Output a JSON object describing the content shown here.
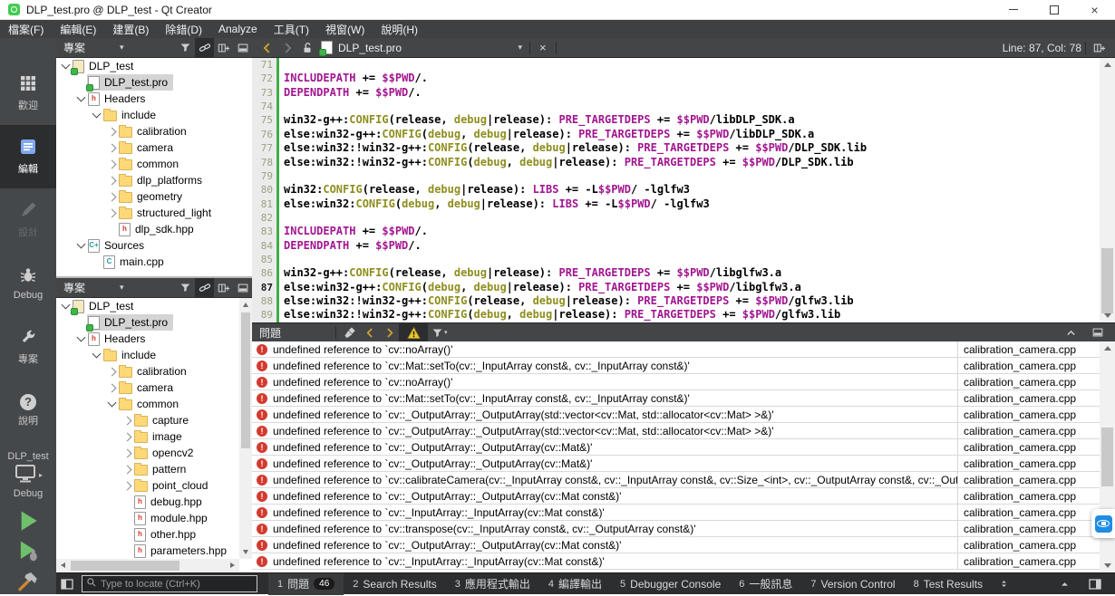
{
  "window": {
    "title": "DLP_test.pro @ DLP_test - Qt Creator",
    "controls": [
      "minimize",
      "restore",
      "close"
    ]
  },
  "menu_bar": {
    "items": [
      "檔案(F)",
      "編輯(E)",
      "建置(B)",
      "除錯(D)",
      "Analyze",
      "工具(T)",
      "視窗(W)",
      "說明(H)"
    ]
  },
  "mode_bar": {
    "modes": [
      {
        "label": "歡迎",
        "icon": "welcome-icon",
        "state": "normal"
      },
      {
        "label": "編輯",
        "icon": "edit-icon",
        "state": "selected"
      },
      {
        "label": "設計",
        "icon": "design-icon",
        "state": "disabled"
      },
      {
        "label": "Debug",
        "icon": "debug-icon",
        "state": "normal"
      },
      {
        "label": "專案",
        "icon": "projects-icon",
        "state": "normal"
      },
      {
        "label": "說明",
        "icon": "help-icon",
        "state": "normal"
      }
    ],
    "kit": {
      "project": "DLP_test",
      "config": "Debug"
    },
    "actions": [
      {
        "name": "run",
        "icon": "play-icon"
      },
      {
        "name": "debug-run",
        "icon": "play-bug-icon"
      },
      {
        "name": "build",
        "icon": "hammer-icon"
      }
    ]
  },
  "nav_panels": {
    "top": {
      "title": "專案",
      "toolbar_icons": [
        "dropdown-arrow",
        "filter-icon",
        "link-editor-icon",
        "split-icon",
        "hide-panel-icon"
      ],
      "tree": [
        {
          "label": "DLP_test",
          "icon": "qt-project-icon",
          "depth": 0,
          "exp": "open"
        },
        {
          "label": "DLP_test.pro",
          "icon": "pro-file-icon",
          "depth": 1,
          "exp": "none",
          "selected": true
        },
        {
          "label": "Headers",
          "icon": "header-file-icon",
          "depth": 1,
          "exp": "open"
        },
        {
          "label": "include",
          "icon": "folder-icon",
          "depth": 2,
          "exp": "open"
        },
        {
          "label": "calibration",
          "icon": "folder-icon",
          "depth": 3,
          "exp": "closed"
        },
        {
          "label": "camera",
          "icon": "folder-icon",
          "depth": 3,
          "exp": "closed"
        },
        {
          "label": "common",
          "icon": "folder-icon",
          "depth": 3,
          "exp": "closed"
        },
        {
          "label": "dlp_platforms",
          "icon": "folder-icon",
          "depth": 3,
          "exp": "closed"
        },
        {
          "label": "geometry",
          "icon": "folder-icon",
          "depth": 3,
          "exp": "closed"
        },
        {
          "label": "structured_light",
          "icon": "folder-icon",
          "depth": 3,
          "exp": "closed"
        },
        {
          "label": "dlp_sdk.hpp",
          "icon": "header-file-icon",
          "depth": 3,
          "exp": "none"
        },
        {
          "label": "Sources",
          "icon": "source-group-icon",
          "depth": 1,
          "exp": "open"
        },
        {
          "label": "main.cpp",
          "icon": "cpp-file-icon",
          "depth": 2,
          "exp": "none"
        }
      ]
    },
    "bottom": {
      "title": "專案",
      "toolbar_icons": [
        "dropdown-arrow",
        "filter-icon",
        "link-editor-icon",
        "split-icon",
        "hide-panel-icon"
      ],
      "tree": [
        {
          "label": "DLP_test",
          "icon": "qt-project-icon",
          "depth": 0,
          "exp": "open"
        },
        {
          "label": "DLP_test.pro",
          "icon": "pro-file-icon",
          "depth": 1,
          "exp": "none",
          "selected": true
        },
        {
          "label": "Headers",
          "icon": "header-file-icon",
          "depth": 1,
          "exp": "open"
        },
        {
          "label": "include",
          "icon": "folder-icon",
          "depth": 2,
          "exp": "open"
        },
        {
          "label": "calibration",
          "icon": "folder-icon",
          "depth": 3,
          "exp": "closed"
        },
        {
          "label": "camera",
          "icon": "folder-icon",
          "depth": 3,
          "exp": "closed"
        },
        {
          "label": "common",
          "icon": "folder-icon",
          "depth": 3,
          "exp": "open"
        },
        {
          "label": "capture",
          "icon": "folder-icon",
          "depth": 4,
          "exp": "closed"
        },
        {
          "label": "image",
          "icon": "folder-icon",
          "depth": 4,
          "exp": "closed"
        },
        {
          "label": "opencv2",
          "icon": "folder-icon",
          "depth": 4,
          "exp": "closed"
        },
        {
          "label": "pattern",
          "icon": "folder-icon",
          "depth": 4,
          "exp": "closed"
        },
        {
          "label": "point_cloud",
          "icon": "folder-icon",
          "depth": 4,
          "exp": "closed"
        },
        {
          "label": "debug.hpp",
          "icon": "header-file-icon",
          "depth": 4,
          "exp": "none"
        },
        {
          "label": "module.hpp",
          "icon": "header-file-icon",
          "depth": 4,
          "exp": "none"
        },
        {
          "label": "other.hpp",
          "icon": "header-file-icon",
          "depth": 4,
          "exp": "none"
        },
        {
          "label": "parameters.hpp",
          "icon": "header-file-icon",
          "depth": 4,
          "exp": "none"
        }
      ]
    }
  },
  "editor": {
    "toolbar": {
      "document_name": "DLP_test.pro",
      "cursor_position": "Line: 87, Col: 78",
      "icons": [
        "back-icon",
        "forward-icon",
        "lock-icon",
        "document-icon",
        "dropdown-arrow",
        "close-icon",
        "split-icon"
      ]
    },
    "current_line": 87,
    "token_colors": {
      "k": "#000000",
      "m": "#a21690",
      "o": "#8e8e20"
    },
    "lines": [
      {
        "n": 71,
        "segs": []
      },
      {
        "n": 72,
        "segs": [
          [
            "INCLUDEPATH",
            "m"
          ],
          [
            " += ",
            "k"
          ],
          [
            "$$PWD",
            "m"
          ],
          [
            "/.",
            "k"
          ]
        ]
      },
      {
        "n": 73,
        "segs": [
          [
            "DEPENDPATH",
            "m"
          ],
          [
            " += ",
            "k"
          ],
          [
            "$$PWD",
            "m"
          ],
          [
            "/.",
            "k"
          ]
        ]
      },
      {
        "n": 74,
        "segs": []
      },
      {
        "n": 75,
        "segs": [
          [
            "win32-g++:",
            "k"
          ],
          [
            "CONFIG",
            "o"
          ],
          [
            "(release, ",
            "k"
          ],
          [
            "debug",
            "o"
          ],
          [
            "|release): ",
            "k"
          ],
          [
            "PRE_TARGETDEPS",
            "m"
          ],
          [
            " += ",
            "k"
          ],
          [
            "$$PWD",
            "m"
          ],
          [
            "/libDLP_SDK.a",
            "k"
          ]
        ]
      },
      {
        "n": 76,
        "segs": [
          [
            "else:win32-g++:",
            "k"
          ],
          [
            "CONFIG",
            "o"
          ],
          [
            "(",
            "k"
          ],
          [
            "debug",
            "o"
          ],
          [
            ", ",
            "k"
          ],
          [
            "debug",
            "o"
          ],
          [
            "|release): ",
            "k"
          ],
          [
            "PRE_TARGETDEPS",
            "m"
          ],
          [
            " += ",
            "k"
          ],
          [
            "$$PWD",
            "m"
          ],
          [
            "/libDLP_SDK.a",
            "k"
          ]
        ]
      },
      {
        "n": 77,
        "segs": [
          [
            "else:win32:!win32-g++:",
            "k"
          ],
          [
            "CONFIG",
            "o"
          ],
          [
            "(release, ",
            "k"
          ],
          [
            "debug",
            "o"
          ],
          [
            "|release): ",
            "k"
          ],
          [
            "PRE_TARGETDEPS",
            "m"
          ],
          [
            " += ",
            "k"
          ],
          [
            "$$PWD",
            "m"
          ],
          [
            "/DLP_SDK.lib",
            "k"
          ]
        ]
      },
      {
        "n": 78,
        "segs": [
          [
            "else:win32:!win32-g++:",
            "k"
          ],
          [
            "CONFIG",
            "o"
          ],
          [
            "(",
            "k"
          ],
          [
            "debug",
            "o"
          ],
          [
            ", ",
            "k"
          ],
          [
            "debug",
            "o"
          ],
          [
            "|release): ",
            "k"
          ],
          [
            "PRE_TARGETDEPS",
            "m"
          ],
          [
            " += ",
            "k"
          ],
          [
            "$$PWD",
            "m"
          ],
          [
            "/DLP_SDK.lib",
            "k"
          ]
        ]
      },
      {
        "n": 79,
        "segs": []
      },
      {
        "n": 80,
        "segs": [
          [
            "win32:",
            "k"
          ],
          [
            "CONFIG",
            "o"
          ],
          [
            "(release, ",
            "k"
          ],
          [
            "debug",
            "o"
          ],
          [
            "|release): ",
            "k"
          ],
          [
            "LIBS",
            "m"
          ],
          [
            " += -L",
            "k"
          ],
          [
            "$$PWD",
            "m"
          ],
          [
            "/ -lglfw3",
            "k"
          ]
        ]
      },
      {
        "n": 81,
        "segs": [
          [
            "else:win32:",
            "k"
          ],
          [
            "CONFIG",
            "o"
          ],
          [
            "(",
            "k"
          ],
          [
            "debug",
            "o"
          ],
          [
            ", ",
            "k"
          ],
          [
            "debug",
            "o"
          ],
          [
            "|release): ",
            "k"
          ],
          [
            "LIBS",
            "m"
          ],
          [
            " += -L",
            "k"
          ],
          [
            "$$PWD",
            "m"
          ],
          [
            "/ -lglfw3",
            "k"
          ]
        ]
      },
      {
        "n": 82,
        "segs": []
      },
      {
        "n": 83,
        "segs": [
          [
            "INCLUDEPATH",
            "m"
          ],
          [
            " += ",
            "k"
          ],
          [
            "$$PWD",
            "m"
          ],
          [
            "/.",
            "k"
          ]
        ]
      },
      {
        "n": 84,
        "segs": [
          [
            "DEPENDPATH",
            "m"
          ],
          [
            " += ",
            "k"
          ],
          [
            "$$PWD",
            "m"
          ],
          [
            "/.",
            "k"
          ]
        ]
      },
      {
        "n": 85,
        "segs": []
      },
      {
        "n": 86,
        "segs": [
          [
            "win32-g++:",
            "k"
          ],
          [
            "CONFIG",
            "o"
          ],
          [
            "(release, ",
            "k"
          ],
          [
            "debug",
            "o"
          ],
          [
            "|release): ",
            "k"
          ],
          [
            "PRE_TARGETDEPS",
            "m"
          ],
          [
            " += ",
            "k"
          ],
          [
            "$$PWD",
            "m"
          ],
          [
            "/libglfw3.a",
            "k"
          ]
        ]
      },
      {
        "n": 87,
        "segs": [
          [
            "else:win32-g++:",
            "k"
          ],
          [
            "CONFIG",
            "o"
          ],
          [
            "(",
            "k"
          ],
          [
            "debug",
            "o"
          ],
          [
            ", ",
            "k"
          ],
          [
            "debug",
            "o"
          ],
          [
            "|release): ",
            "k"
          ],
          [
            "PRE_TARGETDEPS",
            "m"
          ],
          [
            " += ",
            "k"
          ],
          [
            "$$PWD",
            "m"
          ],
          [
            "/libglfw3.a",
            "k"
          ]
        ]
      },
      {
        "n": 88,
        "segs": [
          [
            "else:win32:!win32-g++:",
            "k"
          ],
          [
            "CONFIG",
            "o"
          ],
          [
            "(release, ",
            "k"
          ],
          [
            "debug",
            "o"
          ],
          [
            "|release): ",
            "k"
          ],
          [
            "PRE_TARGETDEPS",
            "m"
          ],
          [
            " += ",
            "k"
          ],
          [
            "$$PWD",
            "m"
          ],
          [
            "/glfw3.lib",
            "k"
          ]
        ]
      },
      {
        "n": 89,
        "segs": [
          [
            "else:win32:!win32-g++:",
            "k"
          ],
          [
            "CONFIG",
            "o"
          ],
          [
            "(",
            "k"
          ],
          [
            "debug",
            "o"
          ],
          [
            ", ",
            "k"
          ],
          [
            "debug",
            "o"
          ],
          [
            "|release): ",
            "k"
          ],
          [
            "PRE_TARGETDEPS",
            "m"
          ],
          [
            " += ",
            "k"
          ],
          [
            "$$PWD",
            "m"
          ],
          [
            "/glfw3.lib",
            "k"
          ]
        ]
      }
    ]
  },
  "issues_panel": {
    "title": "問題",
    "toolbar_icons": [
      "clean-icon",
      "back-icon",
      "forward-icon",
      "warning-filter-icon",
      "filter-icon"
    ],
    "right_icons": [
      "chevron-up-icon",
      "hide-panel-icon"
    ],
    "rows": [
      {
        "text": "undefined reference to `cv::noArray()'",
        "file": "calibration_camera.cpp"
      },
      {
        "text": "undefined reference to `cv::Mat::setTo(cv::_InputArray const&, cv::_InputArray const&)'",
        "file": "calibration_camera.cpp"
      },
      {
        "text": "undefined reference to `cv::noArray()'",
        "file": "calibration_camera.cpp"
      },
      {
        "text": "undefined reference to `cv::Mat::setTo(cv::_InputArray const&, cv::_InputArray const&)'",
        "file": "calibration_camera.cpp"
      },
      {
        "text": "undefined reference to `cv::_OutputArray::_OutputArray(std::vector<cv::Mat, std::allocator<cv::Mat> >&)'",
        "file": "calibration_camera.cpp"
      },
      {
        "text": "undefined reference to `cv::_OutputArray::_OutputArray(std::vector<cv::Mat, std::allocator<cv::Mat> >&)'",
        "file": "calibration_camera.cpp"
      },
      {
        "text": "undefined reference to `cv::_OutputArray::_OutputArray(cv::Mat&)'",
        "file": "calibration_camera.cpp"
      },
      {
        "text": "undefined reference to `cv::_OutputArray::_OutputArray(cv::Mat&)'",
        "file": "calibration_camera.cpp"
      },
      {
        "text": "undefined reference to `cv::calibrateCamera(cv::_InputArray const&, cv::_InputArray const&, cv::Size_<int>, cv::_OutputArray const&, cv::_OutputArray const&, cv::_OutputArray const&)'",
        "file": "calibration_camera.cpp"
      },
      {
        "text": "undefined reference to `cv::_OutputArray::_OutputArray(cv::Mat const&)'",
        "file": "calibration_camera.cpp"
      },
      {
        "text": "undefined reference to `cv::_InputArray::_InputArray(cv::Mat const&)'",
        "file": "calibration_camera.cpp"
      },
      {
        "text": "undefined reference to `cv::transpose(cv::_InputArray const&, cv::_OutputArray const&)'",
        "file": "calibration_camera.cpp"
      },
      {
        "text": "undefined reference to `cv::_OutputArray::_OutputArray(cv::Mat const&)'",
        "file": "calibration_camera.cpp"
      },
      {
        "text": "undefined reference to `cv::_InputArray::_InputArray(cv::Mat const&)'",
        "file": "calibration_camera.cpp"
      }
    ]
  },
  "status_bar": {
    "locator_placeholder": "Type to locate (Ctrl+K)",
    "tabs": [
      {
        "index": "1",
        "label": "問題",
        "badge": "46",
        "active": true
      },
      {
        "index": "2",
        "label": "Search Results"
      },
      {
        "index": "3",
        "label": "應用程式輸出"
      },
      {
        "index": "4",
        "label": "編譯輸出"
      },
      {
        "index": "5",
        "label": "Debugger Console"
      },
      {
        "index": "6",
        "label": "一般訊息"
      },
      {
        "index": "7",
        "label": "Version Control"
      },
      {
        "index": "8",
        "label": "Test Results"
      }
    ]
  },
  "overlay_icon": "teamviewer-icon",
  "colors": {
    "error_red": "#d33a2f",
    "warning_yellow": "#ecc52e",
    "run_green": "#6fc06a",
    "qt_green": "#41cd52",
    "change_bar_green": "#3fae46",
    "accent_gold": "#cda02c",
    "code_variable": "#a21690",
    "code_function": "#8e8e20"
  }
}
